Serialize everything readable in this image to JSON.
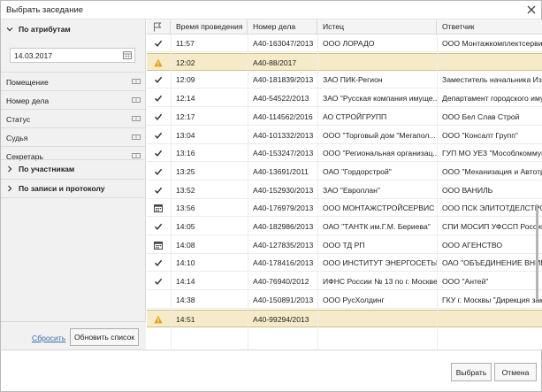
{
  "window": {
    "title": "Выбрать заседание"
  },
  "filters": {
    "attributes_header": "По атрибутам",
    "date_value": "14.03.2017",
    "fields": [
      "Помещение",
      "Номер дела",
      "Статус",
      "Судья",
      "Секретарь"
    ],
    "participants_header": "По участникам",
    "records_header": "По записи и протоколу",
    "reset_label": "Сбросить",
    "refresh_label": "Обновить список"
  },
  "grid": {
    "columns": [
      "",
      "Время проведения",
      "Номер дела",
      "Истец",
      "Ответчик"
    ],
    "rows": [
      {
        "status": "check",
        "time": "11:57",
        "case": "А40-163047/2013",
        "plaintiff": "ООО ЛОРАДО",
        "defendant": "ООО Монтажкомплектсервис"
      },
      {
        "status": "warning",
        "time": "12:02",
        "case": "А40-88/2017",
        "plaintiff": "",
        "defendant": ""
      },
      {
        "status": "check",
        "time": "12:09",
        "case": "А40-181839/2013",
        "plaintiff": "ЗАО ПИК-Регион",
        "defendant": "Заместитель начальника Изма"
      },
      {
        "status": "check",
        "time": "12:14",
        "case": "А40-54522/2013",
        "plaintiff": "ЗАО \"Русская компания имуще...",
        "defendant": "Департамент городского имущ"
      },
      {
        "status": "check",
        "time": "12:17",
        "case": "А40-114562/2016",
        "plaintiff": "АО СТРОЙГРУПП",
        "defendant": "ООО Бел Слав Строй"
      },
      {
        "status": "check",
        "time": "13:04",
        "case": "А40-101332/2013",
        "plaintiff": "ООО \"Торговый дом \"Мегапол...",
        "defendant": "ООО \"Консалт Групп\""
      },
      {
        "status": "check",
        "time": "13:16",
        "case": "А40-153247/2013",
        "plaintiff": "ООО \"Региональная организац...",
        "defendant": "ГУП МО УЕЗ \"Мособлкоммуна"
      },
      {
        "status": "check",
        "time": "13:25",
        "case": "А40-13691/2011",
        "plaintiff": "ОАО \"Гордорстрой\"",
        "defendant": "ООО \"Механизация и Автотра"
      },
      {
        "status": "check",
        "time": "13:52",
        "case": "А40-152930/2013",
        "plaintiff": "ЗАО \"Европлан\"",
        "defendant": "ООО ВАНИЛЬ"
      },
      {
        "status": "calendar",
        "time": "13:56",
        "case": "А40-176979/2013",
        "plaintiff": "ООО МОНТАЖСТРОЙСЕРВИС",
        "defendant": "ООО ПСК ЭЛИТОТДЕЛСТРОЙ"
      },
      {
        "status": "check",
        "time": "14:05",
        "case": "А40-182986/2013",
        "plaintiff": "ОАО \"ТАНТК им.Г.М. Бериева\"",
        "defendant": "СПИ МОСИП УФССП России по"
      },
      {
        "status": "calendar",
        "time": "14:08",
        "case": "А40-127835/2013",
        "plaintiff": "ООО ТД РП",
        "defendant": "ООО АГЕНСТВО"
      },
      {
        "status": "check",
        "time": "14:10",
        "case": "А40-178416/2013",
        "plaintiff": "ООО ИНСТИТУТ ЭНЕРГОСЕТЬП...",
        "defendant": "ОАО \"ОБЪЕДИНЕНИЕ ВНИПИ"
      },
      {
        "status": "check",
        "time": "14:14",
        "case": "А40-76940/2012",
        "plaintiff": "ИФНС России № 13 по г. Москве",
        "defendant": "ООО \"Антей\""
      },
      {
        "status": "none",
        "time": "14:38",
        "case": "А40-150891/2013",
        "plaintiff": "ООО РусХолдинг",
        "defendant": "ГКУ г. Москвы \"Дирекция зака"
      },
      {
        "status": "warning",
        "time": "14:51",
        "case": "А40-99294/2013",
        "plaintiff": "",
        "defendant": ""
      }
    ]
  },
  "buttons": {
    "ok_label": "Выбрать",
    "cancel_label": "Отмена"
  },
  "colors": {
    "warning_row": "#f5ebc9",
    "link": "#3a6cb5",
    "warning_icon": "#e3a019"
  }
}
